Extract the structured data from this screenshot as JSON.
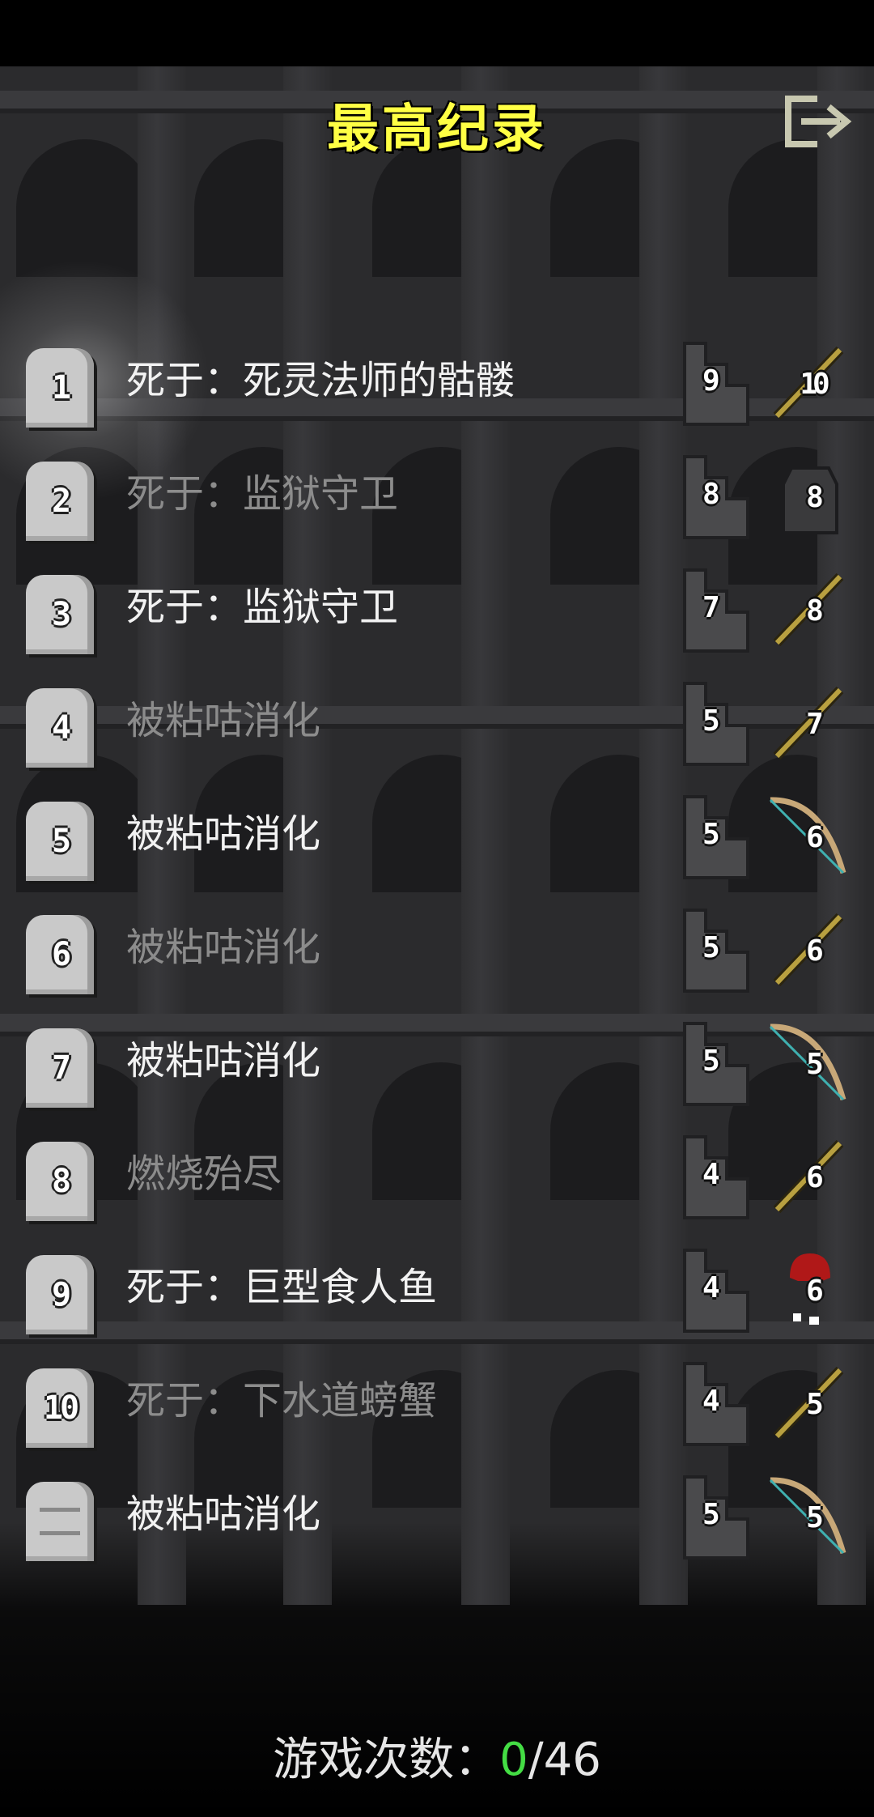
{
  "header": {
    "title": "最高纪录",
    "exit_icon": "exit-icon"
  },
  "records": [
    {
      "rank": "1",
      "cause": "死于：死灵法师的骷髅",
      "depth": "9",
      "item_level": "10",
      "item": "wand",
      "active": true
    },
    {
      "rank": "2",
      "cause": "死于：监狱守卫",
      "depth": "8",
      "item_level": "8",
      "item": "armor",
      "active": false
    },
    {
      "rank": "3",
      "cause": "死于：监狱守卫",
      "depth": "7",
      "item_level": "8",
      "item": "wand",
      "active": true
    },
    {
      "rank": "4",
      "cause": "被粘咕消化",
      "depth": "5",
      "item_level": "7",
      "item": "wand",
      "active": false
    },
    {
      "rank": "5",
      "cause": "被粘咕消化",
      "depth": "5",
      "item_level": "6",
      "item": "bow",
      "active": true
    },
    {
      "rank": "6",
      "cause": "被粘咕消化",
      "depth": "5",
      "item_level": "6",
      "item": "wand",
      "active": false
    },
    {
      "rank": "7",
      "cause": "被粘咕消化",
      "depth": "5",
      "item_level": "5",
      "item": "bow",
      "active": true
    },
    {
      "rank": "8",
      "cause": "燃烧殆尽",
      "depth": "4",
      "item_level": "6",
      "item": "wand",
      "active": false
    },
    {
      "rank": "9",
      "cause": "死于：巨型食人鱼",
      "depth": "4",
      "item_level": "6",
      "item": "potion",
      "active": true
    },
    {
      "rank": "10",
      "cause": "死于：下水道螃蟹",
      "depth": "4",
      "item_level": "5",
      "item": "wand",
      "active": false
    },
    {
      "rank": "",
      "cause": "被粘咕消化",
      "depth": "5",
      "item_level": "5",
      "item": "bow",
      "active": true
    }
  ],
  "footer": {
    "games_label": "游戏次数：",
    "games_won": "0",
    "games_total": "/46"
  },
  "colors": {
    "title": "#ffff44",
    "text_bright": "#f2f2f2",
    "text_dim": "#8c8c8c",
    "won": "#44dd44"
  }
}
